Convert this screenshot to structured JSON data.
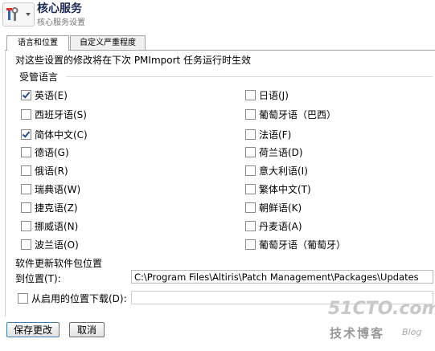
{
  "header": {
    "title": "核心服务",
    "subtitle": "核心服务设置",
    "icon": "tools-icon"
  },
  "tabs": [
    {
      "label": "语言和位置",
      "active": true
    },
    {
      "label": "自定义严重程度",
      "active": false
    }
  ],
  "notice": "对这些设置的修改将在下次 PMImport 任务运行时生效",
  "languages": {
    "group_title": "受管语言",
    "left": [
      {
        "label": "英语(E)",
        "checked": true
      },
      {
        "label": "西班牙语(S)",
        "checked": false
      },
      {
        "label": "简体中文(C)",
        "checked": true
      },
      {
        "label": "德语(G)",
        "checked": false
      },
      {
        "label": "俄语(R)",
        "checked": false
      },
      {
        "label": "瑞典语(W)",
        "checked": false
      },
      {
        "label": "捷克语(Z)",
        "checked": false
      },
      {
        "label": "挪威语(N)",
        "checked": false
      },
      {
        "label": "波兰语(O)",
        "checked": false
      }
    ],
    "right": [
      {
        "label": "日语(J)",
        "checked": false
      },
      {
        "label": "葡萄牙语（巴西）",
        "checked": false
      },
      {
        "label": "法语(F)",
        "checked": false
      },
      {
        "label": "荷兰语(D)",
        "checked": false
      },
      {
        "label": "意大利语(I)",
        "checked": false
      },
      {
        "label": "繁体中文(T)",
        "checked": false
      },
      {
        "label": "朝鲜语(K)",
        "checked": false
      },
      {
        "label": "丹麦语(A)",
        "checked": false
      },
      {
        "label": "葡萄牙语（葡萄牙）",
        "checked": false
      }
    ]
  },
  "package": {
    "title": "软件更新软件包位置",
    "location_label": "到位置(T):",
    "location_value": "C:\\Program Files\\Altiris\\Patch Management\\Packages\\Updates",
    "download_label": "从启用的位置下载(D):",
    "download_checked": false,
    "download_value": ""
  },
  "buttons": {
    "save": "保存更改",
    "cancel": "取消"
  },
  "watermark": {
    "line1": "51CTO.com",
    "line2": "技术博客",
    "line3": "Blog"
  }
}
